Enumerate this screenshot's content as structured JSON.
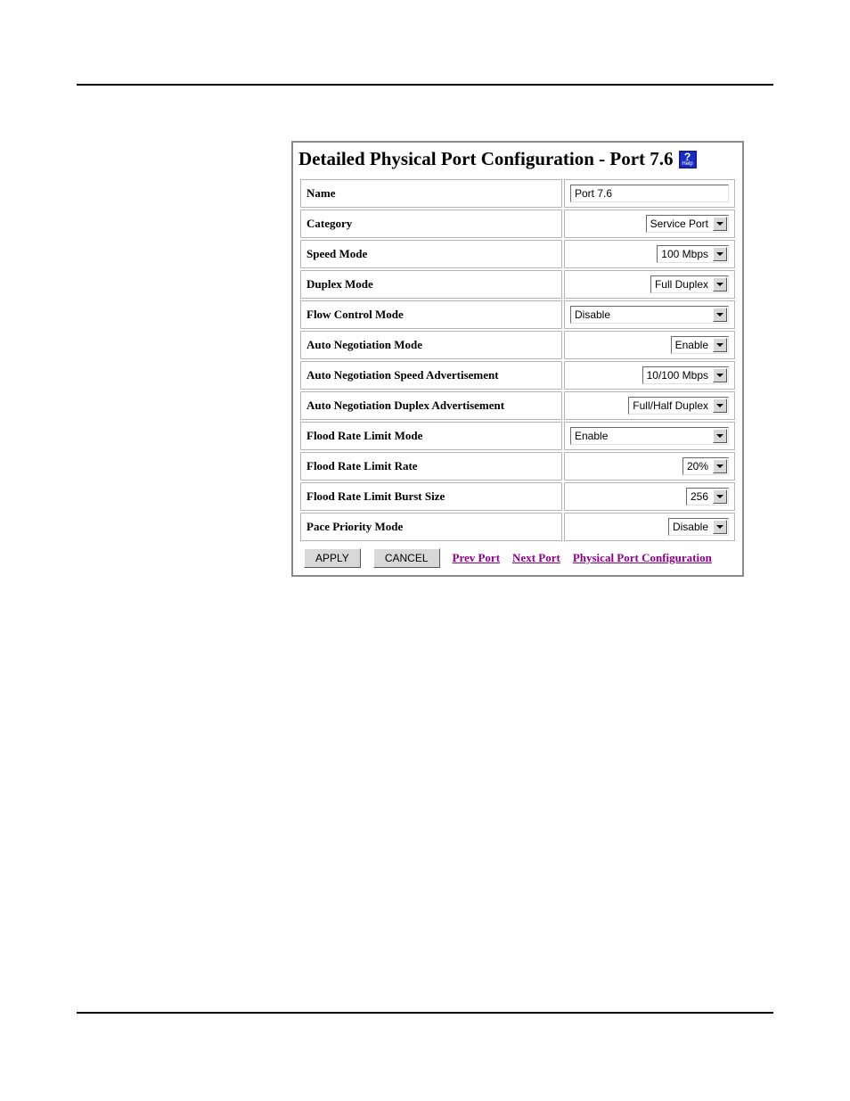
{
  "panel": {
    "title": "Detailed Physical Port Configuration - Port 7.6",
    "help_label": "Help"
  },
  "rows": [
    {
      "label": "Name",
      "value": "Port 7.6",
      "type": "text"
    },
    {
      "label": "Category",
      "value": "Service Port",
      "type": "select",
      "align": "right"
    },
    {
      "label": "Speed Mode",
      "value": "100 Mbps",
      "type": "select",
      "align": "right"
    },
    {
      "label": "Duplex Mode",
      "value": "Full Duplex",
      "type": "select",
      "align": "right"
    },
    {
      "label": "Flow Control Mode",
      "value": "Disable",
      "type": "select",
      "align": "left",
      "full": true
    },
    {
      "label": "Auto Negotiation Mode",
      "value": "Enable",
      "type": "select",
      "align": "right"
    },
    {
      "label": "Auto Negotiation Speed Advertisement",
      "value": "10/100 Mbps",
      "type": "select",
      "align": "right"
    },
    {
      "label": "Auto Negotiation Duplex Advertisement",
      "value": "Full/Half Duplex",
      "type": "select",
      "align": "right"
    },
    {
      "label": "Flood Rate Limit Mode",
      "value": "Enable",
      "type": "select",
      "align": "left",
      "full": true
    },
    {
      "label": "Flood Rate Limit Rate",
      "value": "20%",
      "type": "select",
      "align": "right"
    },
    {
      "label": "Flood Rate Limit Burst Size",
      "value": "256",
      "type": "select",
      "align": "right"
    },
    {
      "label": "Pace Priority Mode",
      "value": "Disable",
      "type": "select",
      "align": "right"
    }
  ],
  "footer": {
    "apply": "APPLY",
    "cancel": "CANCEL",
    "prev": "Prev Port",
    "next": "Next Port",
    "config": "Physical Port Configuration"
  }
}
